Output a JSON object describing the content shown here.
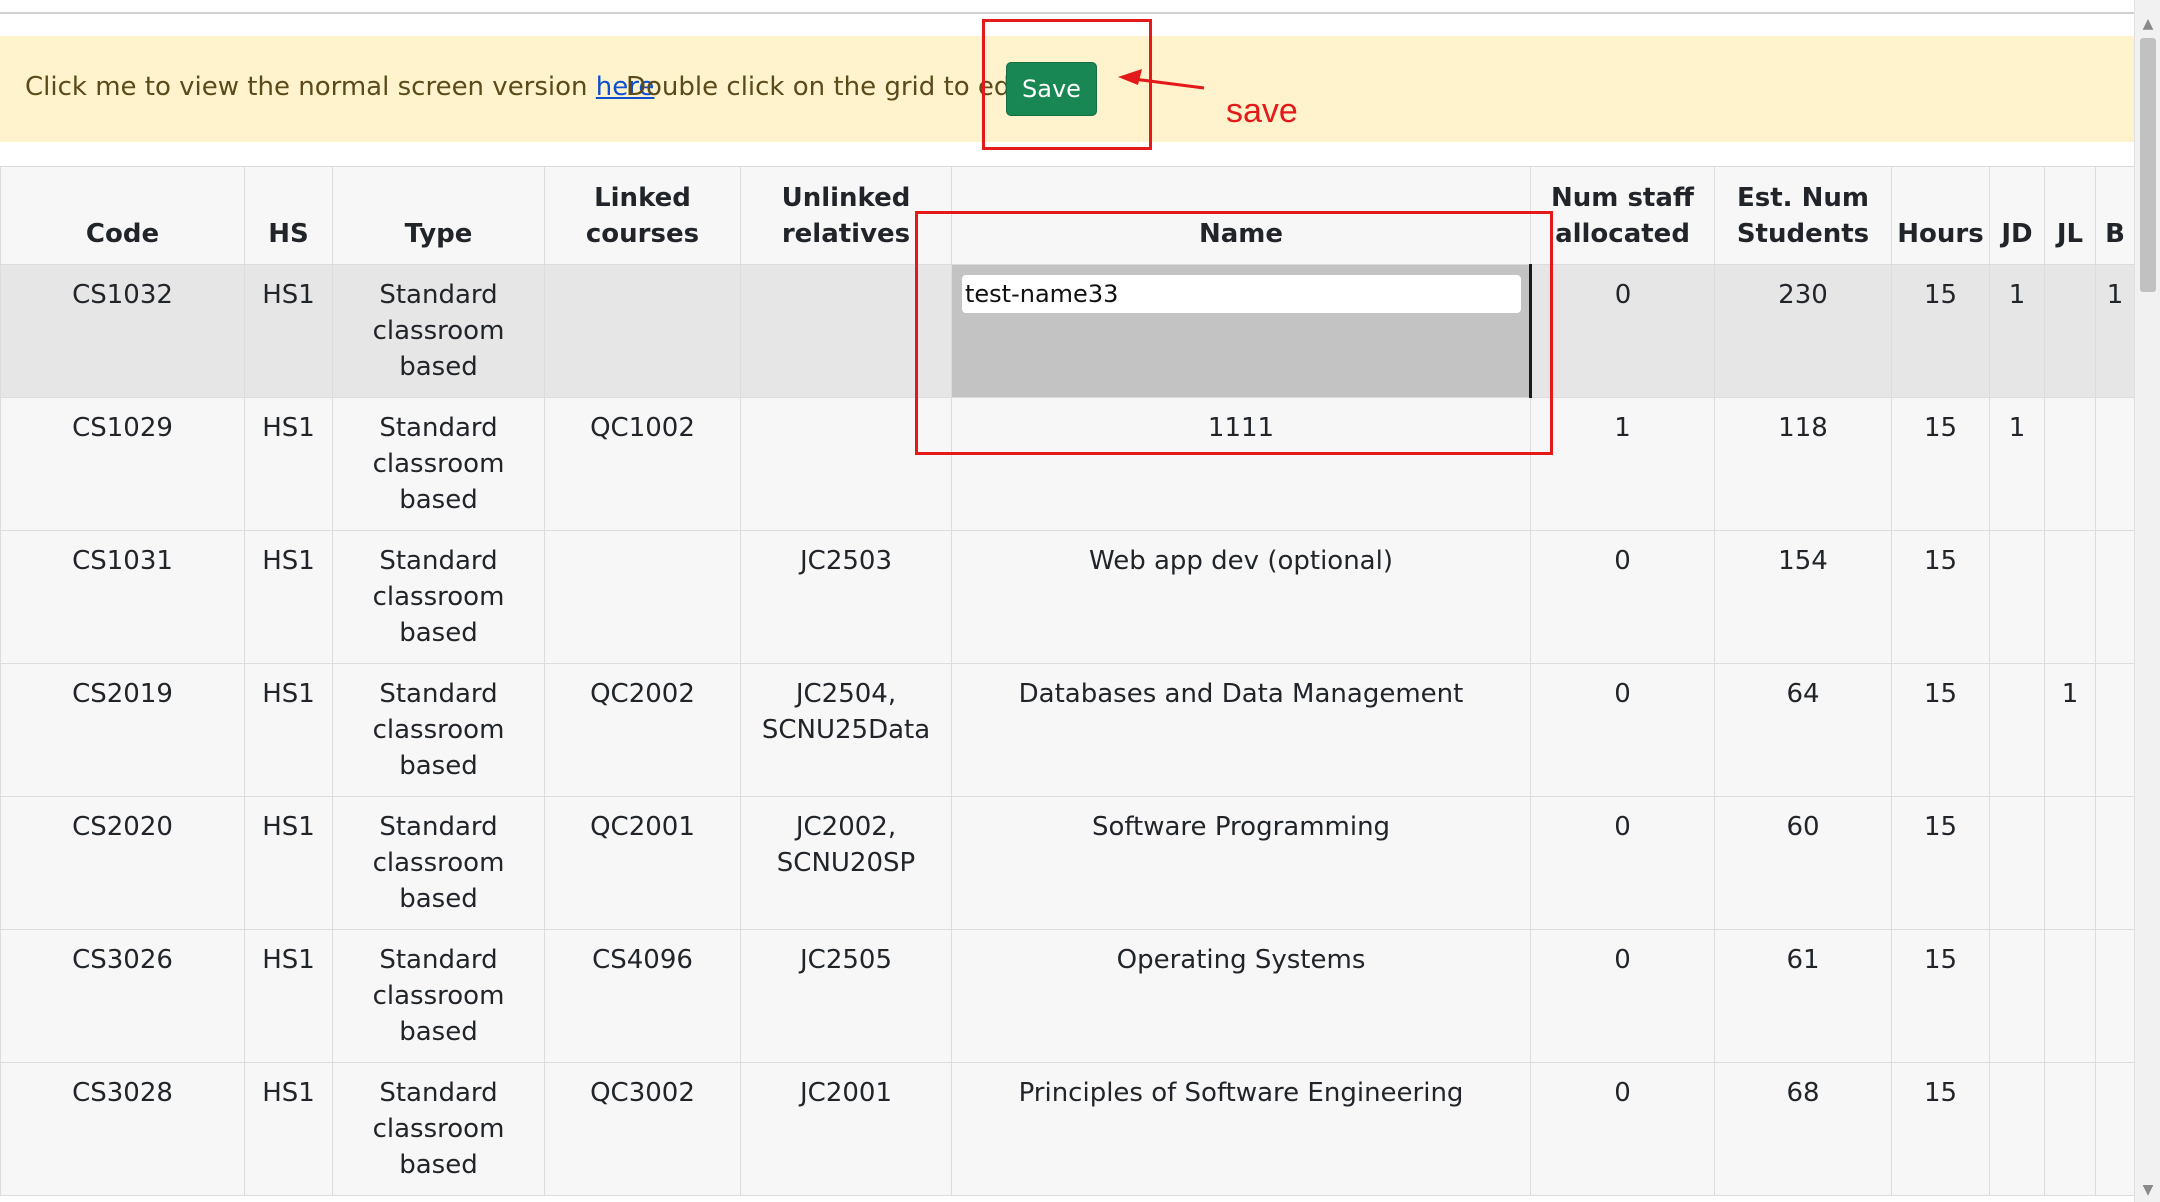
{
  "banner": {
    "text_prefix": "Click me to view the normal screen version",
    "link_text": "here",
    "edit_hint": "Double click on the grid to edit",
    "save_label": "Save"
  },
  "annotations": {
    "save_label": "save",
    "color": "#e41a1a"
  },
  "table": {
    "columns": [
      "Code",
      "HS",
      "Type",
      "Linked courses",
      "Unlinked relatives",
      "Name",
      "Num staff allocated",
      "Est. Num Students",
      "Hours",
      "JD",
      "JL",
      "B"
    ],
    "rows": [
      {
        "code": "CS1032",
        "hs": "HS1",
        "type": "Standard classroom based",
        "linked": "",
        "unlinked": "",
        "name": "test-name33",
        "staff": "0",
        "students": "230",
        "hours": "15",
        "jd": "1",
        "jl": "",
        "b": "1"
      },
      {
        "code": "CS1029",
        "hs": "HS1",
        "type": "Standard classroom based",
        "linked": "QC1002",
        "unlinked": "",
        "name": "1111",
        "staff": "1",
        "students": "118",
        "hours": "15",
        "jd": "1",
        "jl": "",
        "b": ""
      },
      {
        "code": "CS1031",
        "hs": "HS1",
        "type": "Standard classroom based",
        "linked": "",
        "unlinked": "JC2503",
        "name": "Web app dev (optional)",
        "staff": "0",
        "students": "154",
        "hours": "15",
        "jd": "",
        "jl": "",
        "b": ""
      },
      {
        "code": "CS2019",
        "hs": "HS1",
        "type": "Standard classroom based",
        "linked": "QC2002",
        "unlinked": "JC2504, SCNU25Data",
        "name": "Databases and Data Management",
        "staff": "0",
        "students": "64",
        "hours": "15",
        "jd": "",
        "jl": "1",
        "b": ""
      },
      {
        "code": "CS2020",
        "hs": "HS1",
        "type": "Standard classroom based",
        "linked": "QC2001",
        "unlinked": "JC2002, SCNU20SP",
        "name": "Software Programming",
        "staff": "0",
        "students": "60",
        "hours": "15",
        "jd": "",
        "jl": "",
        "b": ""
      },
      {
        "code": "CS3026",
        "hs": "HS1",
        "type": "Standard classroom based",
        "linked": "CS4096",
        "unlinked": "JC2505",
        "name": "Operating Systems",
        "staff": "0",
        "students": "61",
        "hours": "15",
        "jd": "",
        "jl": "",
        "b": ""
      },
      {
        "code": "CS3028",
        "hs": "HS1",
        "type": "Standard classroom based",
        "linked": "QC3002",
        "unlinked": "JC2001",
        "name": "Principles of Software Engineering",
        "staff": "0",
        "students": "68",
        "hours": "15",
        "jd": "",
        "jl": "",
        "b": ""
      }
    ]
  },
  "colors": {
    "banner_bg": "#fff3cd",
    "save_button": "#198754",
    "link": "#0d4fd0",
    "active_row": "#e6e6e6",
    "editing_cell": "#c3c3c3"
  },
  "icons": {
    "scroll_up": "▲",
    "scroll_down": "▼"
  }
}
